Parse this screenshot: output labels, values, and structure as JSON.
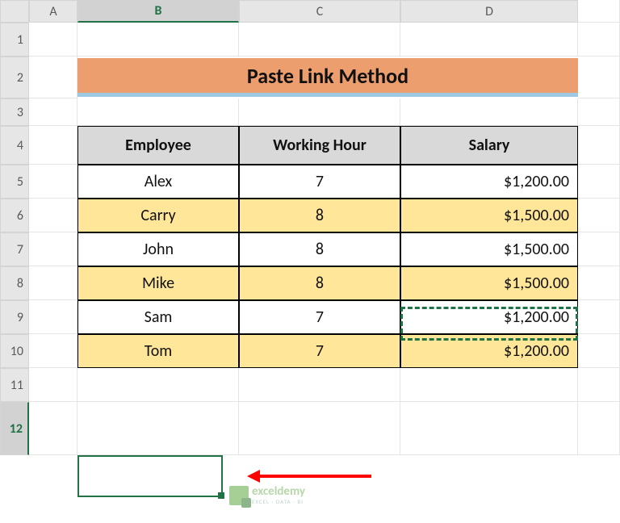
{
  "columns": {
    "A": "A",
    "B": "B",
    "C": "C",
    "D": "D"
  },
  "rows": [
    "1",
    "2",
    "3",
    "4",
    "5",
    "6",
    "7",
    "8",
    "9",
    "10",
    "11",
    "12"
  ],
  "title": "Paste Link Method",
  "headers": {
    "employee": "Employee",
    "working_hour": "Working Hour",
    "salary": "Salary"
  },
  "data": [
    {
      "employee": "Alex",
      "hour": "7",
      "salary": "$1,200.00",
      "fill": false
    },
    {
      "employee": "Carry",
      "hour": "8",
      "salary": "$1,500.00",
      "fill": true
    },
    {
      "employee": "John",
      "hour": "8",
      "salary": "$1,500.00",
      "fill": false
    },
    {
      "employee": "Mike",
      "hour": "8",
      "salary": "$1,500.00",
      "fill": true
    },
    {
      "employee": "Sam",
      "hour": "7",
      "salary": "$1,200.00",
      "fill": false
    },
    {
      "employee": "Tom",
      "hour": "7",
      "salary": "$1,200.00",
      "fill": true
    }
  ],
  "watermark": {
    "brand": "exceldemy",
    "tagline": "EXCEL · DATA · BI"
  },
  "chart_data": {
    "type": "table",
    "title": "Paste Link Method",
    "columns": [
      "Employee",
      "Working Hour",
      "Salary"
    ],
    "rows": [
      [
        "Alex",
        7,
        1200.0
      ],
      [
        "Carry",
        8,
        1500.0
      ],
      [
        "John",
        8,
        1500.0
      ],
      [
        "Mike",
        8,
        1500.0
      ],
      [
        "Sam",
        7,
        1200.0
      ],
      [
        "Tom",
        7,
        1200.0
      ]
    ]
  }
}
